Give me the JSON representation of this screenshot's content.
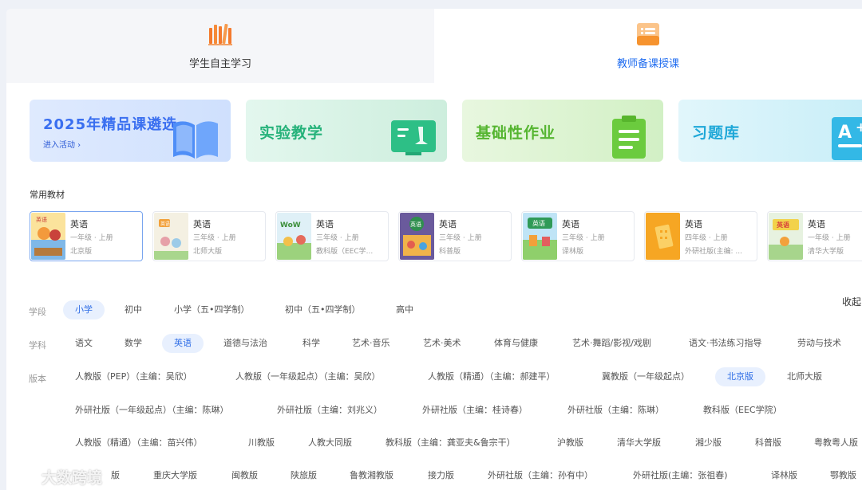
{
  "tabs": [
    {
      "label": "学生自主学习",
      "icon": "books-icon",
      "selected": false
    },
    {
      "label": "教师备课授课",
      "icon": "lesson-plan-icon",
      "selected": true
    }
  ],
  "features": {
    "promo": {
      "title": "2025年精品课遴选",
      "sub": "进入活动 ›"
    },
    "experiment": {
      "title": "实验教学"
    },
    "homework": {
      "title": "基础性作业"
    },
    "exercises": {
      "title": "习题库"
    }
  },
  "textbooks_label": "常用教材",
  "textbooks": [
    {
      "subject": "英语",
      "grade": "一年级 · 上册",
      "edition": "北京版"
    },
    {
      "subject": "英语",
      "grade": "三年级 · 上册",
      "edition": "北师大版"
    },
    {
      "subject": "英语",
      "grade": "三年级 · 上册",
      "edition": "教科版（EEC学..."
    },
    {
      "subject": "英语",
      "grade": "三年级 · 上册",
      "edition": "科普版"
    },
    {
      "subject": "英语",
      "grade": "三年级 · 上册",
      "edition": "译林版"
    },
    {
      "subject": "英语",
      "grade": "四年级 · 上册",
      "edition": "外研社版(主编: ..."
    },
    {
      "subject": "英语",
      "grade": "一年级 · 上册",
      "edition": "清华大学版"
    }
  ],
  "collapse_label": "收起",
  "filters": {
    "stage_label": "学段",
    "stages": [
      "小学",
      "初中",
      "小学（五•四学制）",
      "初中（五•四学制）",
      "高中"
    ],
    "subject_label": "学科",
    "subjects": [
      "语文",
      "数学",
      "英语",
      "道德与法治",
      "科学",
      "艺术·音乐",
      "艺术·美术",
      "体育与健康",
      "艺术·舞蹈/影视/戏剧",
      "语文·书法练习指导",
      "劳动与技术"
    ],
    "edition_label": "版本",
    "editions_row1": [
      "人教版（PEP）（主编：吴欣）",
      "人教版（一年级起点）（主编：吴欣）",
      "人教版（精通）（主编：郝建平）",
      "冀教版（一年级起点）",
      "北京版",
      "北师大版"
    ],
    "editions_row2": [
      "外研社版（一年级起点）（主编：陈琳）",
      "外研社版（主编：刘兆义）",
      "外研社版（主编：桂诗春）",
      "外研社版（主编：陈琳）",
      "教科版（EEC学院）"
    ],
    "editions_row3": [
      "人教版（精通）（主编：苗兴伟）",
      "川教版",
      "人教大同版",
      "教科版（主编：龚亚夫&鲁宗干）",
      "沪教版",
      "清华大学版",
      "湘少版",
      "科普版",
      "粤教粤人版"
    ],
    "editions_row4": [
      "版",
      "重庆大学版",
      "闽教版",
      "陕旅版",
      "鲁教湘教版",
      "接力版",
      "外研社版（主编：孙有中）",
      "外研社版(主编：张祖春)",
      "译林版",
      "鄂教版"
    ]
  },
  "watermark": "大数跨境"
}
